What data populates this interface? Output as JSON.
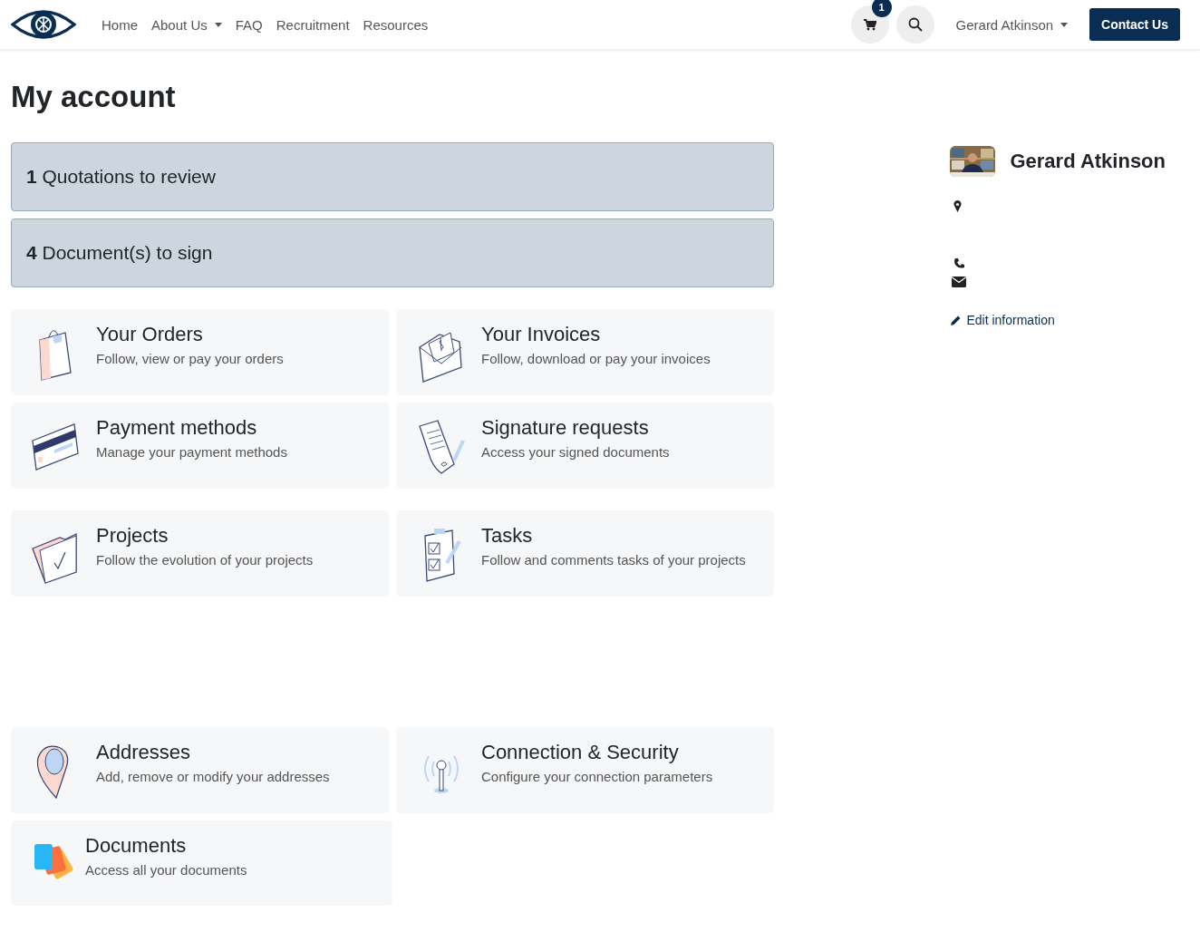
{
  "navbar": {
    "menu": [
      {
        "label": "Home",
        "dropdown": false
      },
      {
        "label": "About Us",
        "dropdown": true
      },
      {
        "label": "FAQ",
        "dropdown": false
      },
      {
        "label": "Recruitment",
        "dropdown": false
      },
      {
        "label": "Resources",
        "dropdown": false
      }
    ],
    "cart_count": "1",
    "user": "Gerard Atkinson",
    "contact_button": "Contact Us"
  },
  "page_title": "My account",
  "alerts": [
    "**1** Quotations to review",
    "**4** Document(s) to sign"
  ],
  "card_groups": [
    [
      {
        "kind": "orders",
        "title": "Your Orders",
        "description": "Follow, view or pay your orders"
      },
      {
        "kind": "invoices",
        "title": "Your Invoices",
        "description": "Follow, download or pay your invoices"
      },
      {
        "kind": "payment",
        "title": "Payment methods",
        "description": "Manage your payment methods"
      },
      {
        "kind": "signature",
        "title": "Signature requests",
        "description": "Access your signed documents"
      }
    ],
    [
      {
        "kind": "projects",
        "title": "Projects",
        "description": "Follow the evolution of your projects"
      },
      {
        "kind": "tasks",
        "title": "Tasks",
        "description": "Follow and comments tasks of your projects"
      }
    ],
    [
      {
        "kind": "addresses",
        "title": "Addresses",
        "description": "Add, remove or modify your addresses"
      },
      {
        "kind": "security",
        "title": "Connection & Security",
        "description": "Configure your connection parameters"
      },
      {
        "kind": "documents",
        "title": "Documents",
        "description": "Access all your documents"
      }
    ]
  ],
  "profile": {
    "name": "Gerard Atkinson",
    "edit_link": "Edit information"
  }
}
